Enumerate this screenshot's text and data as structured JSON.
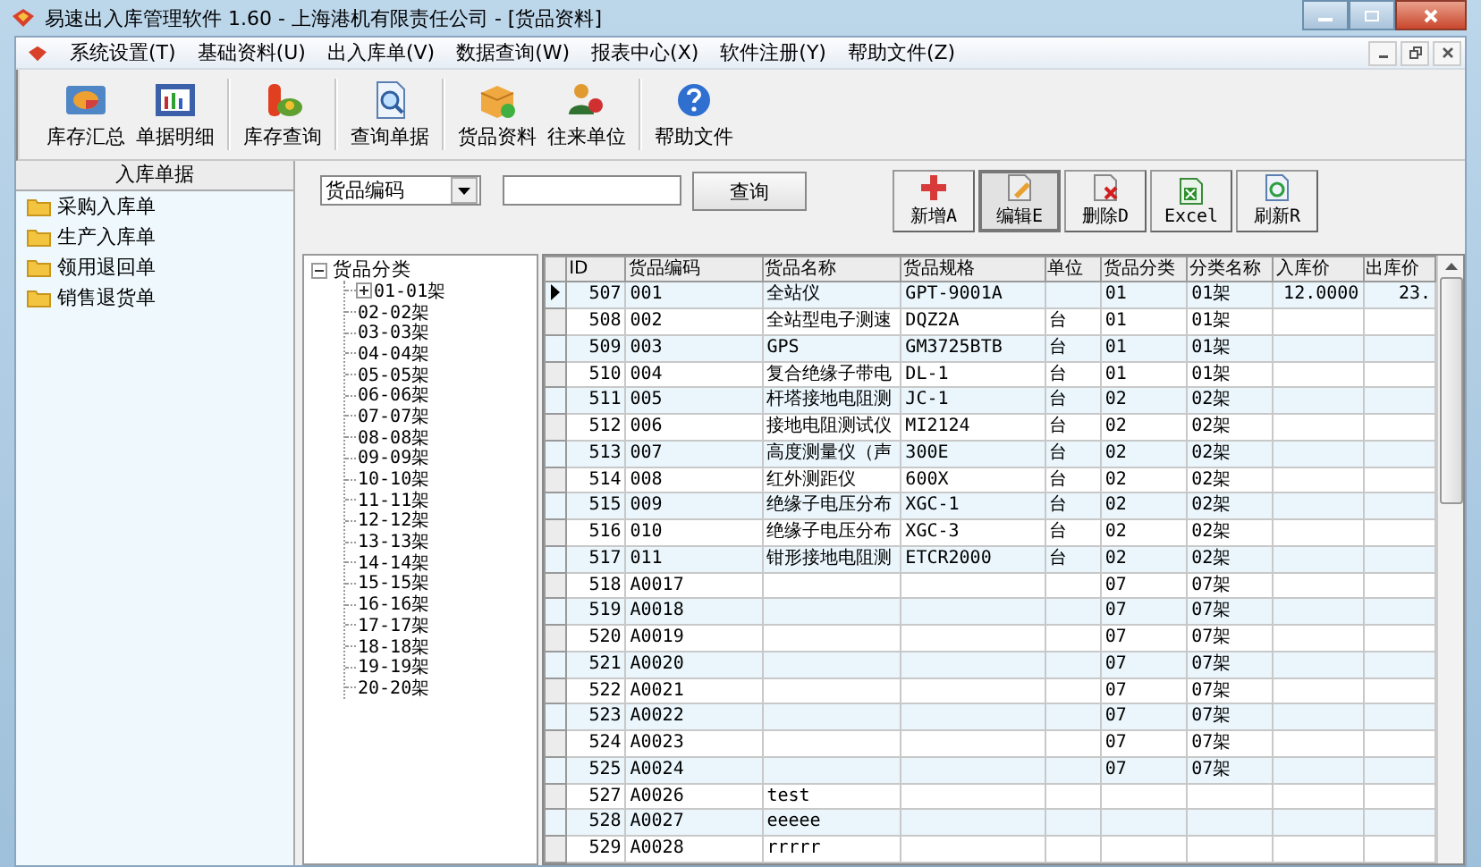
{
  "window": {
    "title": "易速出入库管理软件 1.60 - 上海港机有限责任公司 - [货品资料]"
  },
  "menu": [
    "系统设置(T)",
    "基础资料(U)",
    "出入库单(V)",
    "数据查询(W)",
    "报表中心(X)",
    "软件注册(Y)",
    "帮助文件(Z)"
  ],
  "toolbar": [
    {
      "label": "库存汇总",
      "kind": "pie"
    },
    {
      "label": "单据明细",
      "kind": "bars"
    },
    {
      "label": "库存查询",
      "kind": "stock"
    },
    {
      "label": "查询单据",
      "kind": "search"
    },
    {
      "label": "货品资料",
      "kind": "box"
    },
    {
      "label": "往来单位",
      "kind": "people"
    },
    {
      "label": "帮助文件",
      "kind": "help"
    }
  ],
  "left_panel": {
    "title": "入库单据",
    "items": [
      "采购入库单",
      "生产入库单",
      "领用退回单",
      "销售退货单"
    ]
  },
  "search": {
    "field": "货品编码",
    "button": "查询"
  },
  "actions": [
    {
      "label": "新增A",
      "kind": "add",
      "selected": false
    },
    {
      "label": "编辑E",
      "kind": "edit",
      "selected": true
    },
    {
      "label": "删除D",
      "kind": "delete",
      "selected": false
    },
    {
      "label": "Excel",
      "kind": "excel",
      "selected": false
    },
    {
      "label": "刷新R",
      "kind": "refresh",
      "selected": false
    }
  ],
  "tree": {
    "label": "货品分类",
    "expanded": true,
    "children": [
      {
        "label": "01-01架",
        "expanded": false
      },
      {
        "label": "02-02架"
      },
      {
        "label": "03-03架"
      },
      {
        "label": "04-04架"
      },
      {
        "label": "05-05架"
      },
      {
        "label": "06-06架"
      },
      {
        "label": "07-07架"
      },
      {
        "label": "08-08架"
      },
      {
        "label": "09-09架"
      },
      {
        "label": "10-10架"
      },
      {
        "label": "11-11架"
      },
      {
        "label": "12-12架"
      },
      {
        "label": "13-13架"
      },
      {
        "label": "14-14架"
      },
      {
        "label": "15-15架"
      },
      {
        "label": "16-16架"
      },
      {
        "label": "17-17架"
      },
      {
        "label": "18-18架"
      },
      {
        "label": "19-19架"
      },
      {
        "label": "20-20架"
      }
    ]
  },
  "table": {
    "columns": [
      "ID",
      "货品编码",
      "货品名称",
      "货品规格",
      "单位",
      "货品分类",
      "分类名称",
      "入库价",
      "出库价"
    ],
    "rows": [
      {
        "selected": true,
        "cells": [
          "507",
          "001",
          "全站仪",
          "GPT-9001A",
          null,
          "01",
          "01架",
          "12.0000",
          "23."
        ]
      },
      {
        "selected": false,
        "cells": [
          "508",
          "002",
          "全站型电子测速",
          "DQZ2A",
          "台",
          "01",
          "01架",
          null,
          null
        ]
      },
      {
        "selected": false,
        "cells": [
          "509",
          "003",
          "GPS",
          "GM3725BTB",
          "台",
          "01",
          "01架",
          null,
          null
        ]
      },
      {
        "selected": false,
        "cells": [
          "510",
          "004",
          "复合绝缘子带电",
          "DL-1",
          "台",
          "01",
          "01架",
          null,
          null
        ]
      },
      {
        "selected": false,
        "cells": [
          "511",
          "005",
          "杆塔接地电阻测",
          "JC-1",
          "台",
          "02",
          "02架",
          null,
          null
        ]
      },
      {
        "selected": false,
        "cells": [
          "512",
          "006",
          "接地电阻测试仪",
          "MI2124",
          "台",
          "02",
          "02架",
          null,
          null
        ]
      },
      {
        "selected": false,
        "cells": [
          "513",
          "007",
          "高度测量仪（声",
          "300E",
          "台",
          "02",
          "02架",
          null,
          null
        ]
      },
      {
        "selected": false,
        "cells": [
          "514",
          "008",
          "红外测距仪",
          "600X",
          "台",
          "02",
          "02架",
          null,
          null
        ]
      },
      {
        "selected": false,
        "cells": [
          "515",
          "009",
          "绝缘子电压分布",
          "XGC-1",
          "台",
          "02",
          "02架",
          null,
          null
        ]
      },
      {
        "selected": false,
        "cells": [
          "516",
          "010",
          "绝缘子电压分布",
          "XGC-3",
          "台",
          "02",
          "02架",
          null,
          null
        ]
      },
      {
        "selected": false,
        "cells": [
          "517",
          "011",
          "钳形接地电阻测",
          "ETCR2000",
          "台",
          "02",
          "02架",
          null,
          null
        ]
      },
      {
        "selected": false,
        "cells": [
          "518",
          "A0017",
          null,
          null,
          null,
          "07",
          "07架",
          null,
          null
        ]
      },
      {
        "selected": false,
        "cells": [
          "519",
          "A0018",
          null,
          null,
          null,
          "07",
          "07架",
          null,
          null
        ]
      },
      {
        "selected": false,
        "cells": [
          "520",
          "A0019",
          null,
          null,
          null,
          "07",
          "07架",
          null,
          null
        ]
      },
      {
        "selected": false,
        "cells": [
          "521",
          "A0020",
          null,
          null,
          null,
          "07",
          "07架",
          null,
          null
        ]
      },
      {
        "selected": false,
        "cells": [
          "522",
          "A0021",
          null,
          null,
          null,
          "07",
          "07架",
          null,
          null
        ]
      },
      {
        "selected": false,
        "cells": [
          "523",
          "A0022",
          null,
          null,
          null,
          "07",
          "07架",
          null,
          null
        ]
      },
      {
        "selected": false,
        "cells": [
          "524",
          "A0023",
          null,
          null,
          null,
          "07",
          "07架",
          null,
          null
        ]
      },
      {
        "selected": false,
        "cells": [
          "525",
          "A0024",
          null,
          null,
          null,
          "07",
          "07架",
          null,
          null
        ]
      },
      {
        "selected": false,
        "cells": [
          "527",
          "A0026",
          "test",
          null,
          null,
          null,
          null,
          null,
          null
        ]
      },
      {
        "selected": false,
        "cells": [
          "528",
          "A0027",
          "eeeee",
          null,
          null,
          null,
          null,
          null,
          null
        ]
      },
      {
        "selected": false,
        "cells": [
          "529",
          "A0028",
          "rrrrr",
          null,
          null,
          null,
          null,
          null,
          null
        ]
      }
    ]
  }
}
